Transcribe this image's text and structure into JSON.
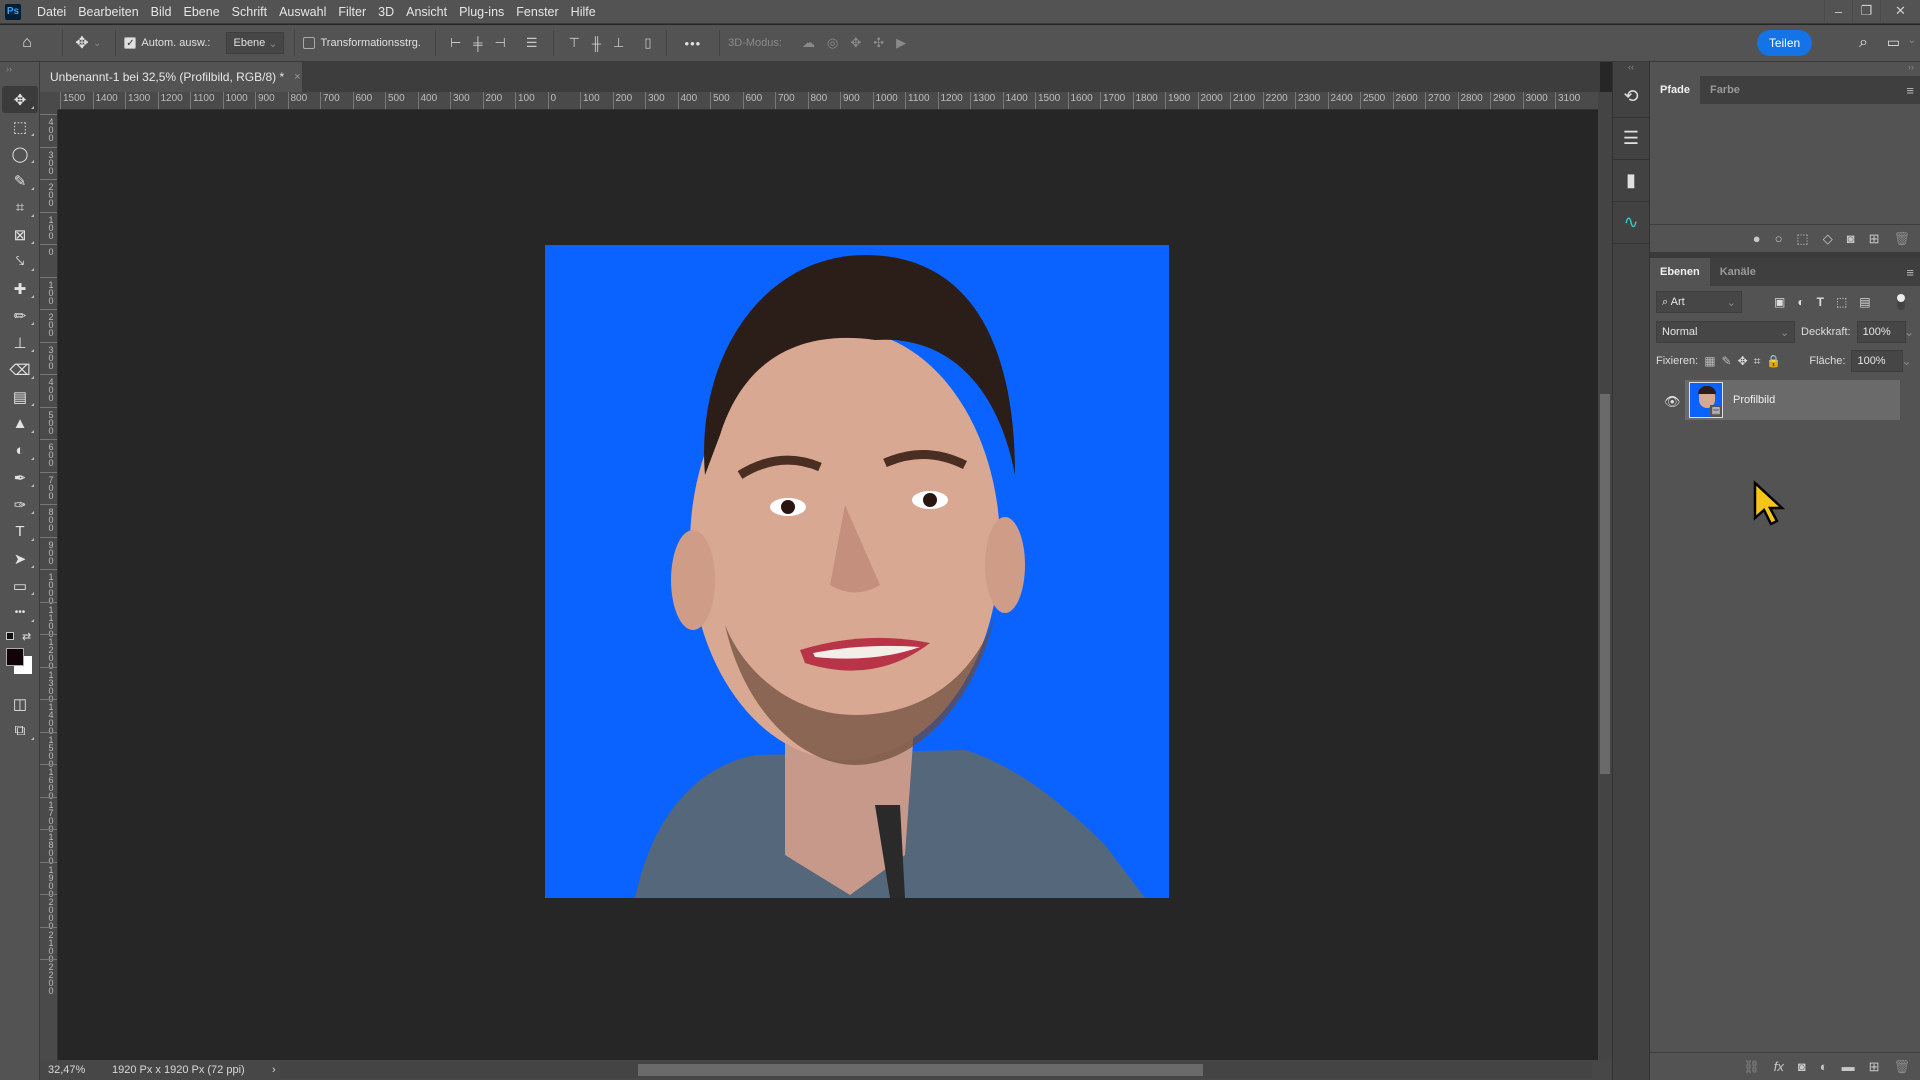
{
  "app": {
    "logo": "Ps",
    "name": "Adobe Photoshop"
  },
  "menubar": {
    "items": [
      "Datei",
      "Bearbeiten",
      "Bild",
      "Ebene",
      "Schrift",
      "Auswahl",
      "Filter",
      "3D",
      "Ansicht",
      "Plug-ins",
      "Fenster",
      "Hilfe"
    ],
    "window_controls": {
      "minimize": "–",
      "restore": "❐",
      "close": "✕"
    }
  },
  "options_bar": {
    "home_icon": "⌂",
    "move_icon": "✥",
    "auto_select_label": "Autom. ausw.:",
    "auto_select_checked": true,
    "auto_select_target": "Ebene",
    "transform_controls_label": "Transformationsstrg.",
    "transform_controls_checked": false,
    "more_label": "•••",
    "mode_3d_label": "3D-Modus:",
    "share_label": "Teilen"
  },
  "document": {
    "tab_title": "Unbenannt-1 bei 32,5% (Profilbild, RGB/8) *",
    "close": "×",
    "background_color": "#0a63ff"
  },
  "rulers": {
    "horizontal": [
      "1500",
      "1400",
      "1300",
      "1200",
      "1100",
      "1000",
      "900",
      "800",
      "700",
      "600",
      "500",
      "400",
      "300",
      "200",
      "100",
      "0",
      "100",
      "200",
      "300",
      "400",
      "500",
      "600",
      "700",
      "800",
      "900",
      "1000",
      "1100",
      "1200",
      "1300",
      "1400",
      "1500",
      "1600",
      "1700",
      "1800",
      "1900",
      "2000",
      "2100",
      "2200",
      "2300",
      "2400",
      "2500",
      "2600",
      "2700",
      "2800",
      "2900",
      "3000",
      "3100"
    ],
    "vertical": [
      "400",
      "300",
      "200",
      "100",
      "0",
      "100",
      "200",
      "300",
      "400",
      "500",
      "600",
      "700",
      "800",
      "900",
      "1000",
      "1100",
      "1200",
      "1300",
      "1400",
      "1500",
      "1600",
      "1700",
      "1800",
      "1900",
      "2000",
      "2100",
      "2200"
    ]
  },
  "status_bar": {
    "zoom": "32,47%",
    "doc_info": "1920 Px x 1920 Px (72 ppi)",
    "arrow": "›"
  },
  "tools": [
    {
      "name": "move-tool",
      "glyph": "✥",
      "active": true
    },
    {
      "name": "marquee-tool",
      "glyph": "⬚"
    },
    {
      "name": "lasso-tool",
      "glyph": "◯"
    },
    {
      "name": "quick-selection-tool",
      "glyph": "✎"
    },
    {
      "name": "crop-tool",
      "glyph": "⌗"
    },
    {
      "name": "frame-tool",
      "glyph": "⊠"
    },
    {
      "name": "eyedropper-tool",
      "glyph": "⤥"
    },
    {
      "name": "healing-brush-tool",
      "glyph": "✚"
    },
    {
      "name": "brush-tool",
      "glyph": "✏"
    },
    {
      "name": "stamp-tool",
      "glyph": "⊥"
    },
    {
      "name": "eraser-tool",
      "glyph": "⌫"
    },
    {
      "name": "gradient-tool",
      "glyph": "▤"
    },
    {
      "name": "blur-tool",
      "glyph": "▲"
    },
    {
      "name": "dodge-tool",
      "glyph": "◐"
    },
    {
      "name": "pen-tool",
      "glyph": "✒"
    },
    {
      "name": "curvature-pen-tool",
      "glyph": "✑"
    },
    {
      "name": "type-tool",
      "glyph": "T"
    },
    {
      "name": "path-selection-tool",
      "glyph": "➤"
    },
    {
      "name": "rectangle-tool",
      "glyph": "▭"
    },
    {
      "name": "edit-toolbar",
      "glyph": "•••"
    }
  ],
  "colors": {
    "foreground": "#120308",
    "background": "#ffffff"
  },
  "icon_column": [
    "history-icon",
    "layers-3d-icon",
    "libraries-icon",
    "curves-icon"
  ],
  "paths_panel": {
    "tabs": [
      {
        "label": "Pfade",
        "active": true
      },
      {
        "label": "Farbe",
        "active": false
      }
    ],
    "footer_icons": [
      "fill-path-icon",
      "stroke-path-icon",
      "load-selection-icon",
      "make-work-path-icon",
      "add-mask-icon",
      "new-path-icon",
      "delete-icon"
    ]
  },
  "layers_panel": {
    "tabs": [
      {
        "label": "Ebenen",
        "active": true
      },
      {
        "label": "Kanäle",
        "active": false
      }
    ],
    "filter_kind": "Art",
    "blend_mode": "Normal",
    "opacity_label": "Deckkraft:",
    "opacity": "100%",
    "lock_label": "Fixieren:",
    "fill_label": "Fläche:",
    "fill": "100%",
    "layers": [
      {
        "name": "Profilbild",
        "visible": true,
        "smart_object": true
      }
    ],
    "footer_icons": [
      "link-icon",
      "fx-icon",
      "mask-icon",
      "adjustment-icon",
      "group-icon",
      "new-layer-icon",
      "delete-icon"
    ]
  }
}
